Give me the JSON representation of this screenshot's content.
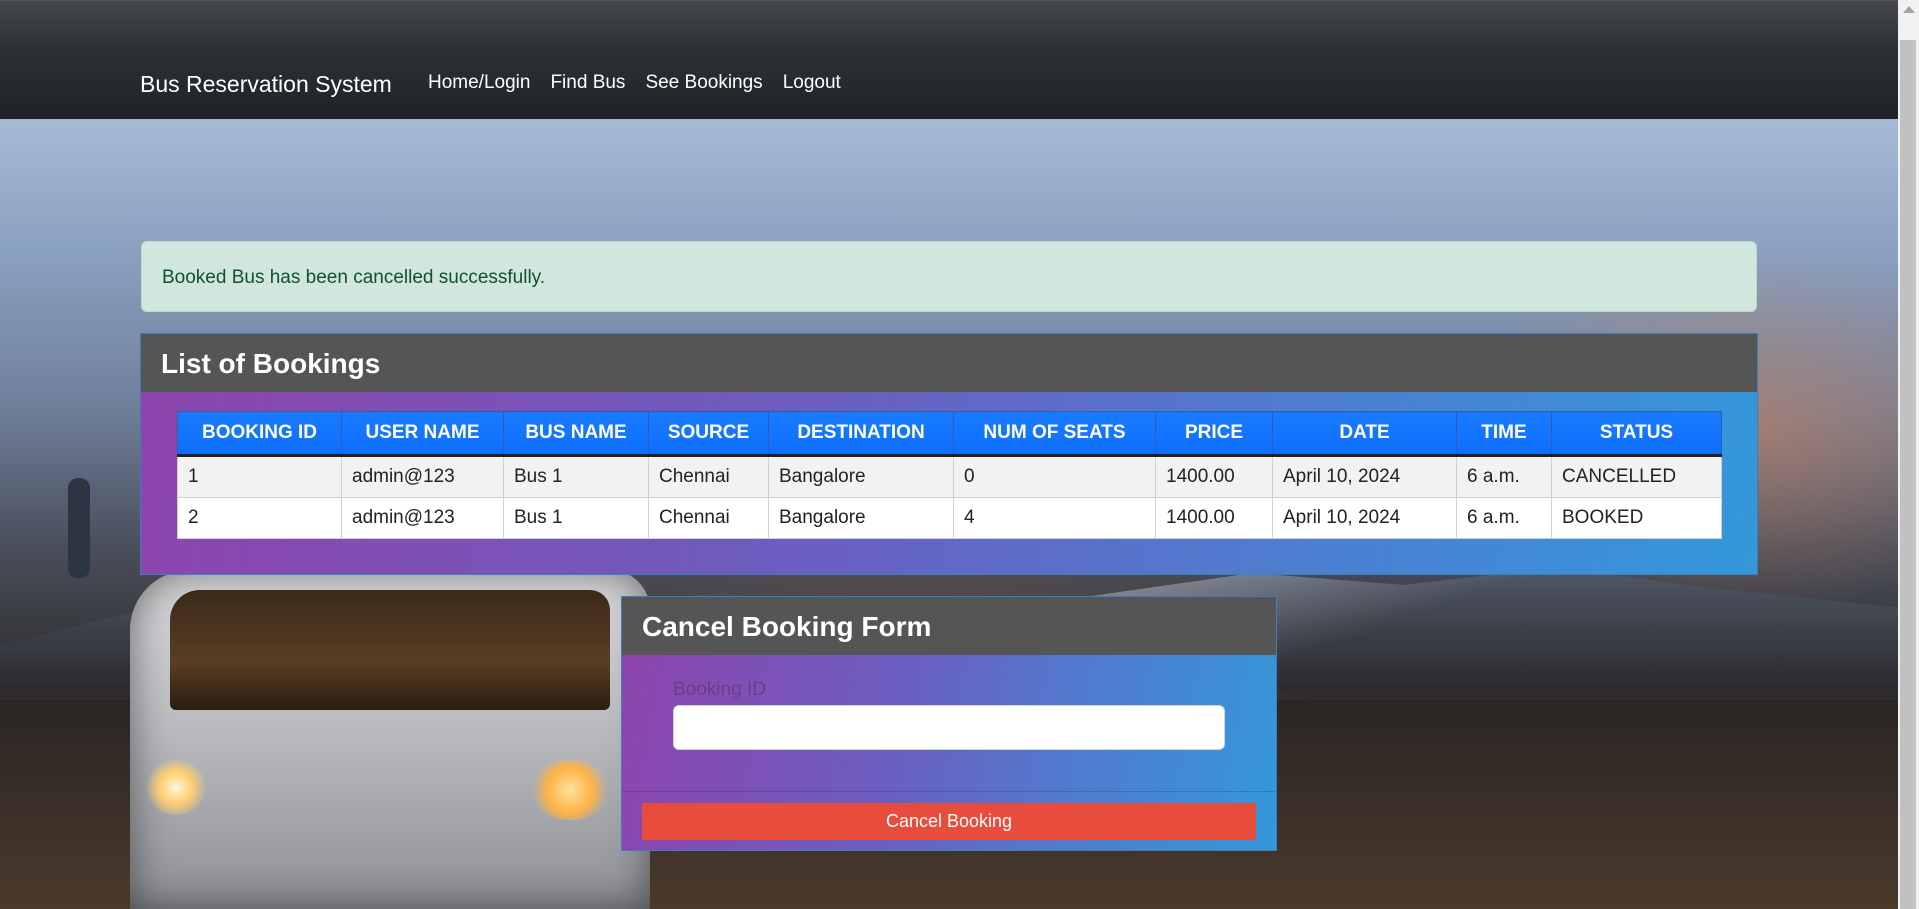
{
  "navbar": {
    "brand": "Bus Reservation System",
    "links": [
      "Home/Login",
      "Find Bus",
      "See Bookings",
      "Logout"
    ]
  },
  "alert": {
    "message": "Booked Bus has been cancelled successfully.",
    "color": "#d1e7dd"
  },
  "bookings": {
    "title": "List of Bookings",
    "columns": [
      "BOOKING ID",
      "USER NAME",
      "BUS NAME",
      "SOURCE",
      "DESTINATION",
      "NUM OF SEATS",
      "PRICE",
      "DATE",
      "TIME",
      "STATUS"
    ],
    "rows": [
      [
        "1",
        "admin@123",
        "Bus 1",
        "Chennai",
        "Bangalore",
        "0",
        "1400.00",
        "April 10, 2024",
        "6 a.m.",
        "CANCELLED"
      ],
      [
        "2",
        "admin@123",
        "Bus 1",
        "Chennai",
        "Bangalore",
        "4",
        "1400.00",
        "April 10, 2024",
        "6 a.m.",
        "BOOKED"
      ]
    ]
  },
  "cancel_form": {
    "title": "Cancel Booking Form",
    "field_label": "Booking ID",
    "field_value": "",
    "button_label": "Cancel Booking",
    "button_color": "#e74c3c"
  }
}
